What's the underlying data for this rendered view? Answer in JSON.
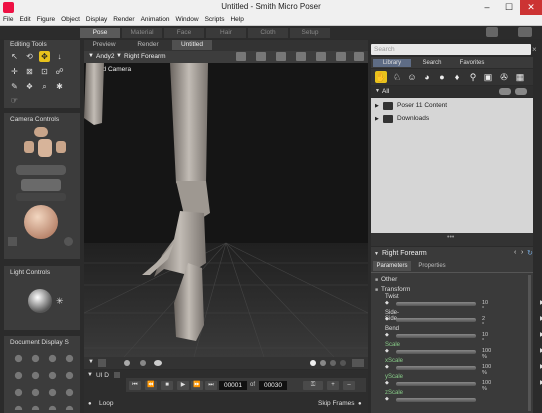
{
  "window": {
    "title": "Untitled - Smith Micro Poser",
    "min": "–",
    "max": "☐",
    "close": "✕"
  },
  "menu": [
    "File",
    "Edit",
    "Figure",
    "Object",
    "Display",
    "Render",
    "Animation",
    "Window",
    "Scripts",
    "Help"
  ],
  "rooms": [
    "Pose",
    "Material",
    "Face",
    "Hair",
    "Cloth",
    "Setup"
  ],
  "left": {
    "editing_tools": "Editing Tools",
    "camera_controls": "Camera Controls",
    "light_controls": "Light Controls",
    "document_display": "Document Display S"
  },
  "doc_tabs": [
    "Preview",
    "Render",
    "Untitled"
  ],
  "viewport": {
    "figure": "Andy2",
    "part": "Right Forearm",
    "camera": "LHand Camera"
  },
  "library": {
    "search_placeholder": "Search",
    "tabs": [
      "Library",
      "Search",
      "Favorites"
    ],
    "filter": "All",
    "folders": [
      "Poser 11 Content",
      "Downloads"
    ]
  },
  "params": {
    "actor": "Right Forearm",
    "tabs": [
      "Parameters",
      "Properties"
    ],
    "groups": [
      "Other",
      "Transform"
    ],
    "rows": [
      {
        "name": "Twist",
        "value": "10 °"
      },
      {
        "name": "Side-Side",
        "value": "2 °"
      },
      {
        "name": "Bend",
        "value": "10 °"
      },
      {
        "name": "Scale",
        "value": "100 %"
      },
      {
        "name": "xScale",
        "value": "100 %"
      },
      {
        "name": "yScale",
        "value": "100 %"
      },
      {
        "name": "zScale",
        "value": ""
      }
    ]
  },
  "timeline": {
    "frame": "00001",
    "of": "of",
    "total": "00030",
    "loop": "Loop",
    "skip": "Skip Frames",
    "ui": "UI D"
  },
  "colors": {
    "accent": "#e8c21c",
    "viewport": "#151515"
  }
}
